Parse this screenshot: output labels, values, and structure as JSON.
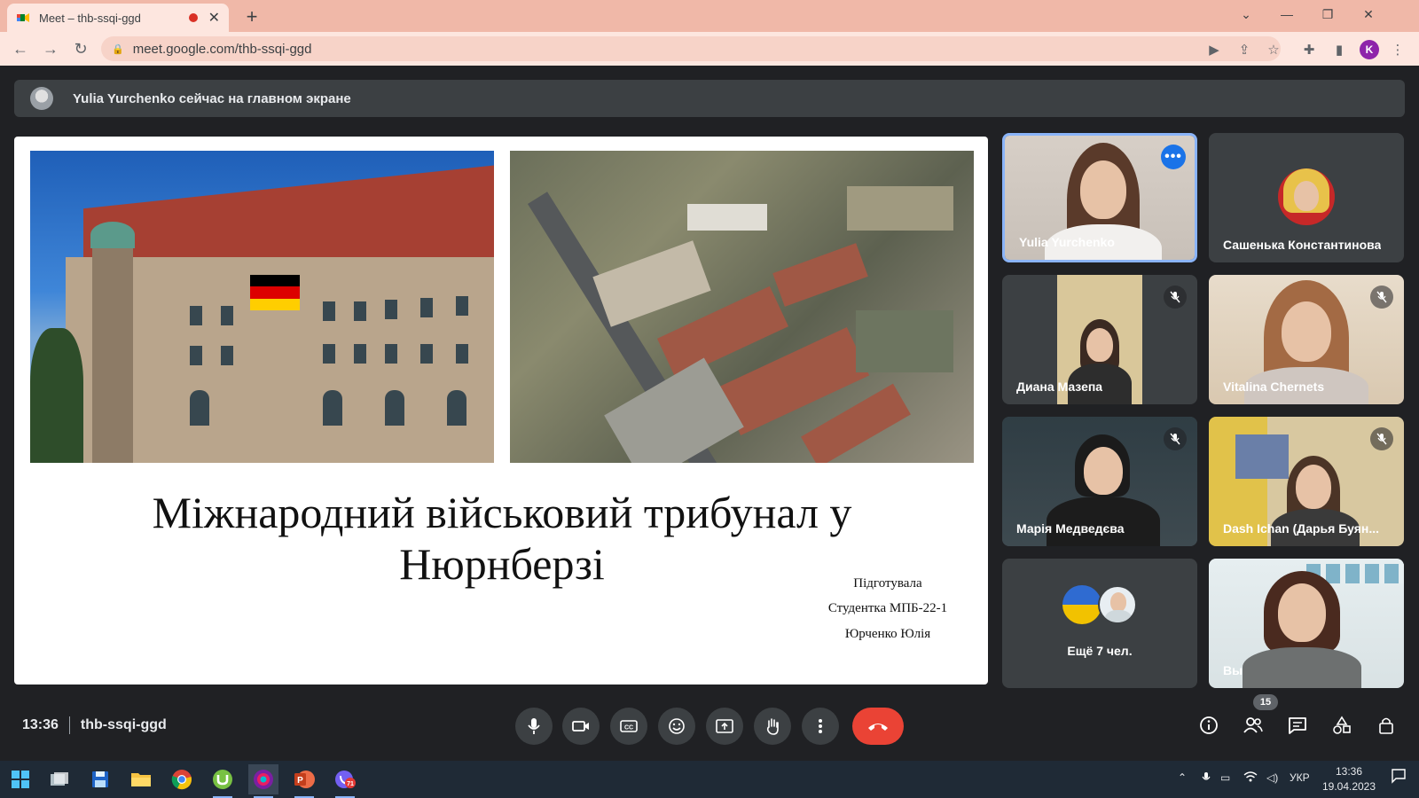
{
  "browser": {
    "tab_title": "Meet – thb-ssqi-ggd",
    "url": "meet.google.com/thb-ssqi-ggd",
    "profile_initial": "K"
  },
  "banner": {
    "text": "Yulia Yurchenko сейчас на главном экране"
  },
  "slide": {
    "title_line1": "Міжнародний військовий трибунал у",
    "title_line2": "Нюрнберзі",
    "credit_line1": "Підготувала",
    "credit_line2": "Студентка МПБ-22-1",
    "credit_line3": "Юрченко Юлія"
  },
  "participants": [
    {
      "name": "Yulia Yurchenko",
      "muted": false,
      "active": true
    },
    {
      "name": "Сашенька Константинова",
      "muted": false
    },
    {
      "name": "Диана Мазепа",
      "muted": true
    },
    {
      "name": "Vitalina Chernets",
      "muted": true
    },
    {
      "name": "Марія Медведєва",
      "muted": true
    },
    {
      "name": "Dash Ichan (Дарья Буян...",
      "muted": true
    },
    {
      "name": "Ещё 7 чел."
    },
    {
      "name": "Вы"
    }
  ],
  "meeting": {
    "time": "13:36",
    "code": "thb-ssqi-ggd",
    "participant_count": "15"
  },
  "controls": [
    "mic-icon",
    "camera-icon",
    "captions-icon",
    "emoji-icon",
    "present-icon",
    "raise-hand-icon",
    "more-options-icon",
    "end-call-icon"
  ],
  "side_controls": [
    "info-icon",
    "people-icon",
    "chat-icon",
    "activities-icon",
    "host-controls-icon"
  ],
  "taskbar": {
    "apps": [
      "windows-start-icon",
      "task-view-icon",
      "save-icon",
      "file-explorer-icon",
      "chrome-icon",
      "utorrent-icon",
      "screen-recorder-icon",
      "powerpoint-icon",
      "viber-icon"
    ],
    "viber_badge": "71",
    "language": "УКР",
    "clock_time": "13:36",
    "clock_date": "19.04.2023"
  },
  "colors": {
    "meet_bg": "#202124",
    "tile_bg": "#3c4043",
    "active_border": "#8ab4f8",
    "end_call": "#ea4335",
    "browser_theme": "#f0b8a8"
  }
}
